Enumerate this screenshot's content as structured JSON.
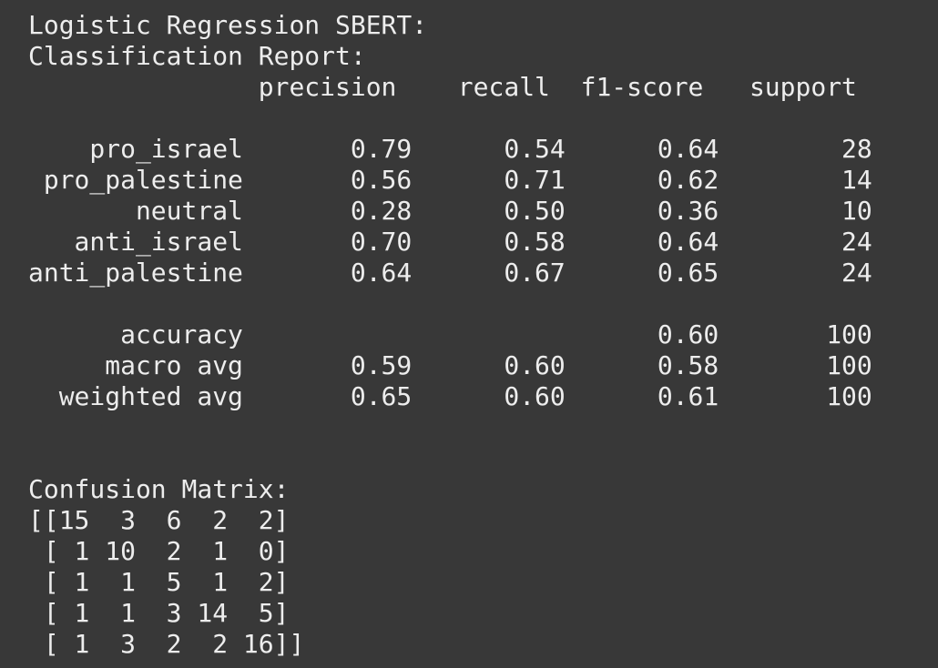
{
  "output": {
    "model_title": "Logistic Regression SBERT:",
    "report_title": "Classification Report:",
    "report_header": "               precision    recall  f1-score   support",
    "rows": {
      "pro_israel": "    pro_israel       0.79      0.54      0.64        28",
      "pro_palestine": " pro_palestine       0.56      0.71      0.62        14",
      "neutral": "       neutral       0.28      0.50      0.36        10",
      "anti_israel": "   anti_israel       0.70      0.58      0.64        24",
      "anti_palestine": "anti_palestine       0.64      0.67      0.65        24"
    },
    "summary": {
      "accuracy": "      accuracy                           0.60       100",
      "macro_avg": "     macro avg       0.59      0.60      0.58       100",
      "weighted_avg": "  weighted avg       0.65      0.60      0.61       100"
    },
    "confusion_title": "Confusion Matrix:",
    "confusion_rows": [
      "[[15  3  6  2  2]",
      " [ 1 10  2  1  0]",
      " [ 1  1  5  1  2]",
      " [ 1  1  3 14  5]",
      " [ 1  3  2  2 16]]"
    ]
  }
}
